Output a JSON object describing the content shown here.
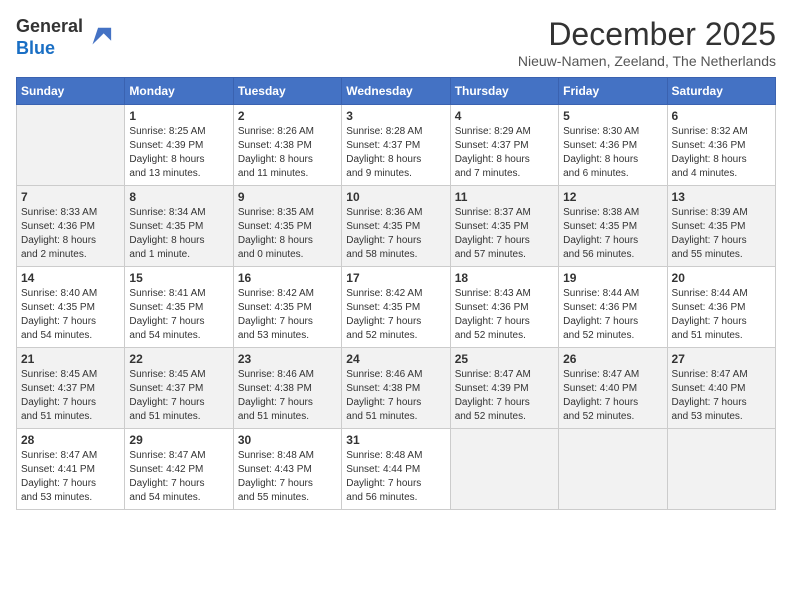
{
  "header": {
    "logo_line1": "General",
    "logo_line2": "Blue",
    "month_title": "December 2025",
    "subtitle": "Nieuw-Namen, Zeeland, The Netherlands"
  },
  "columns": [
    "Sunday",
    "Monday",
    "Tuesday",
    "Wednesday",
    "Thursday",
    "Friday",
    "Saturday"
  ],
  "weeks": [
    [
      {
        "day": "",
        "info": ""
      },
      {
        "day": "1",
        "info": "Sunrise: 8:25 AM\nSunset: 4:39 PM\nDaylight: 8 hours\nand 13 minutes."
      },
      {
        "day": "2",
        "info": "Sunrise: 8:26 AM\nSunset: 4:38 PM\nDaylight: 8 hours\nand 11 minutes."
      },
      {
        "day": "3",
        "info": "Sunrise: 8:28 AM\nSunset: 4:37 PM\nDaylight: 8 hours\nand 9 minutes."
      },
      {
        "day": "4",
        "info": "Sunrise: 8:29 AM\nSunset: 4:37 PM\nDaylight: 8 hours\nand 7 minutes."
      },
      {
        "day": "5",
        "info": "Sunrise: 8:30 AM\nSunset: 4:36 PM\nDaylight: 8 hours\nand 6 minutes."
      },
      {
        "day": "6",
        "info": "Sunrise: 8:32 AM\nSunset: 4:36 PM\nDaylight: 8 hours\nand 4 minutes."
      }
    ],
    [
      {
        "day": "7",
        "info": "Sunrise: 8:33 AM\nSunset: 4:36 PM\nDaylight: 8 hours\nand 2 minutes."
      },
      {
        "day": "8",
        "info": "Sunrise: 8:34 AM\nSunset: 4:35 PM\nDaylight: 8 hours\nand 1 minute."
      },
      {
        "day": "9",
        "info": "Sunrise: 8:35 AM\nSunset: 4:35 PM\nDaylight: 8 hours\nand 0 minutes."
      },
      {
        "day": "10",
        "info": "Sunrise: 8:36 AM\nSunset: 4:35 PM\nDaylight: 7 hours\nand 58 minutes."
      },
      {
        "day": "11",
        "info": "Sunrise: 8:37 AM\nSunset: 4:35 PM\nDaylight: 7 hours\nand 57 minutes."
      },
      {
        "day": "12",
        "info": "Sunrise: 8:38 AM\nSunset: 4:35 PM\nDaylight: 7 hours\nand 56 minutes."
      },
      {
        "day": "13",
        "info": "Sunrise: 8:39 AM\nSunset: 4:35 PM\nDaylight: 7 hours\nand 55 minutes."
      }
    ],
    [
      {
        "day": "14",
        "info": "Sunrise: 8:40 AM\nSunset: 4:35 PM\nDaylight: 7 hours\nand 54 minutes."
      },
      {
        "day": "15",
        "info": "Sunrise: 8:41 AM\nSunset: 4:35 PM\nDaylight: 7 hours\nand 54 minutes."
      },
      {
        "day": "16",
        "info": "Sunrise: 8:42 AM\nSunset: 4:35 PM\nDaylight: 7 hours\nand 53 minutes."
      },
      {
        "day": "17",
        "info": "Sunrise: 8:42 AM\nSunset: 4:35 PM\nDaylight: 7 hours\nand 52 minutes."
      },
      {
        "day": "18",
        "info": "Sunrise: 8:43 AM\nSunset: 4:36 PM\nDaylight: 7 hours\nand 52 minutes."
      },
      {
        "day": "19",
        "info": "Sunrise: 8:44 AM\nSunset: 4:36 PM\nDaylight: 7 hours\nand 52 minutes."
      },
      {
        "day": "20",
        "info": "Sunrise: 8:44 AM\nSunset: 4:36 PM\nDaylight: 7 hours\nand 51 minutes."
      }
    ],
    [
      {
        "day": "21",
        "info": "Sunrise: 8:45 AM\nSunset: 4:37 PM\nDaylight: 7 hours\nand 51 minutes."
      },
      {
        "day": "22",
        "info": "Sunrise: 8:45 AM\nSunset: 4:37 PM\nDaylight: 7 hours\nand 51 minutes."
      },
      {
        "day": "23",
        "info": "Sunrise: 8:46 AM\nSunset: 4:38 PM\nDaylight: 7 hours\nand 51 minutes."
      },
      {
        "day": "24",
        "info": "Sunrise: 8:46 AM\nSunset: 4:38 PM\nDaylight: 7 hours\nand 51 minutes."
      },
      {
        "day": "25",
        "info": "Sunrise: 8:47 AM\nSunset: 4:39 PM\nDaylight: 7 hours\nand 52 minutes."
      },
      {
        "day": "26",
        "info": "Sunrise: 8:47 AM\nSunset: 4:40 PM\nDaylight: 7 hours\nand 52 minutes."
      },
      {
        "day": "27",
        "info": "Sunrise: 8:47 AM\nSunset: 4:40 PM\nDaylight: 7 hours\nand 53 minutes."
      }
    ],
    [
      {
        "day": "28",
        "info": "Sunrise: 8:47 AM\nSunset: 4:41 PM\nDaylight: 7 hours\nand 53 minutes."
      },
      {
        "day": "29",
        "info": "Sunrise: 8:47 AM\nSunset: 4:42 PM\nDaylight: 7 hours\nand 54 minutes."
      },
      {
        "day": "30",
        "info": "Sunrise: 8:48 AM\nSunset: 4:43 PM\nDaylight: 7 hours\nand 55 minutes."
      },
      {
        "day": "31",
        "info": "Sunrise: 8:48 AM\nSunset: 4:44 PM\nDaylight: 7 hours\nand 56 minutes."
      },
      {
        "day": "",
        "info": ""
      },
      {
        "day": "",
        "info": ""
      },
      {
        "day": "",
        "info": ""
      }
    ]
  ]
}
